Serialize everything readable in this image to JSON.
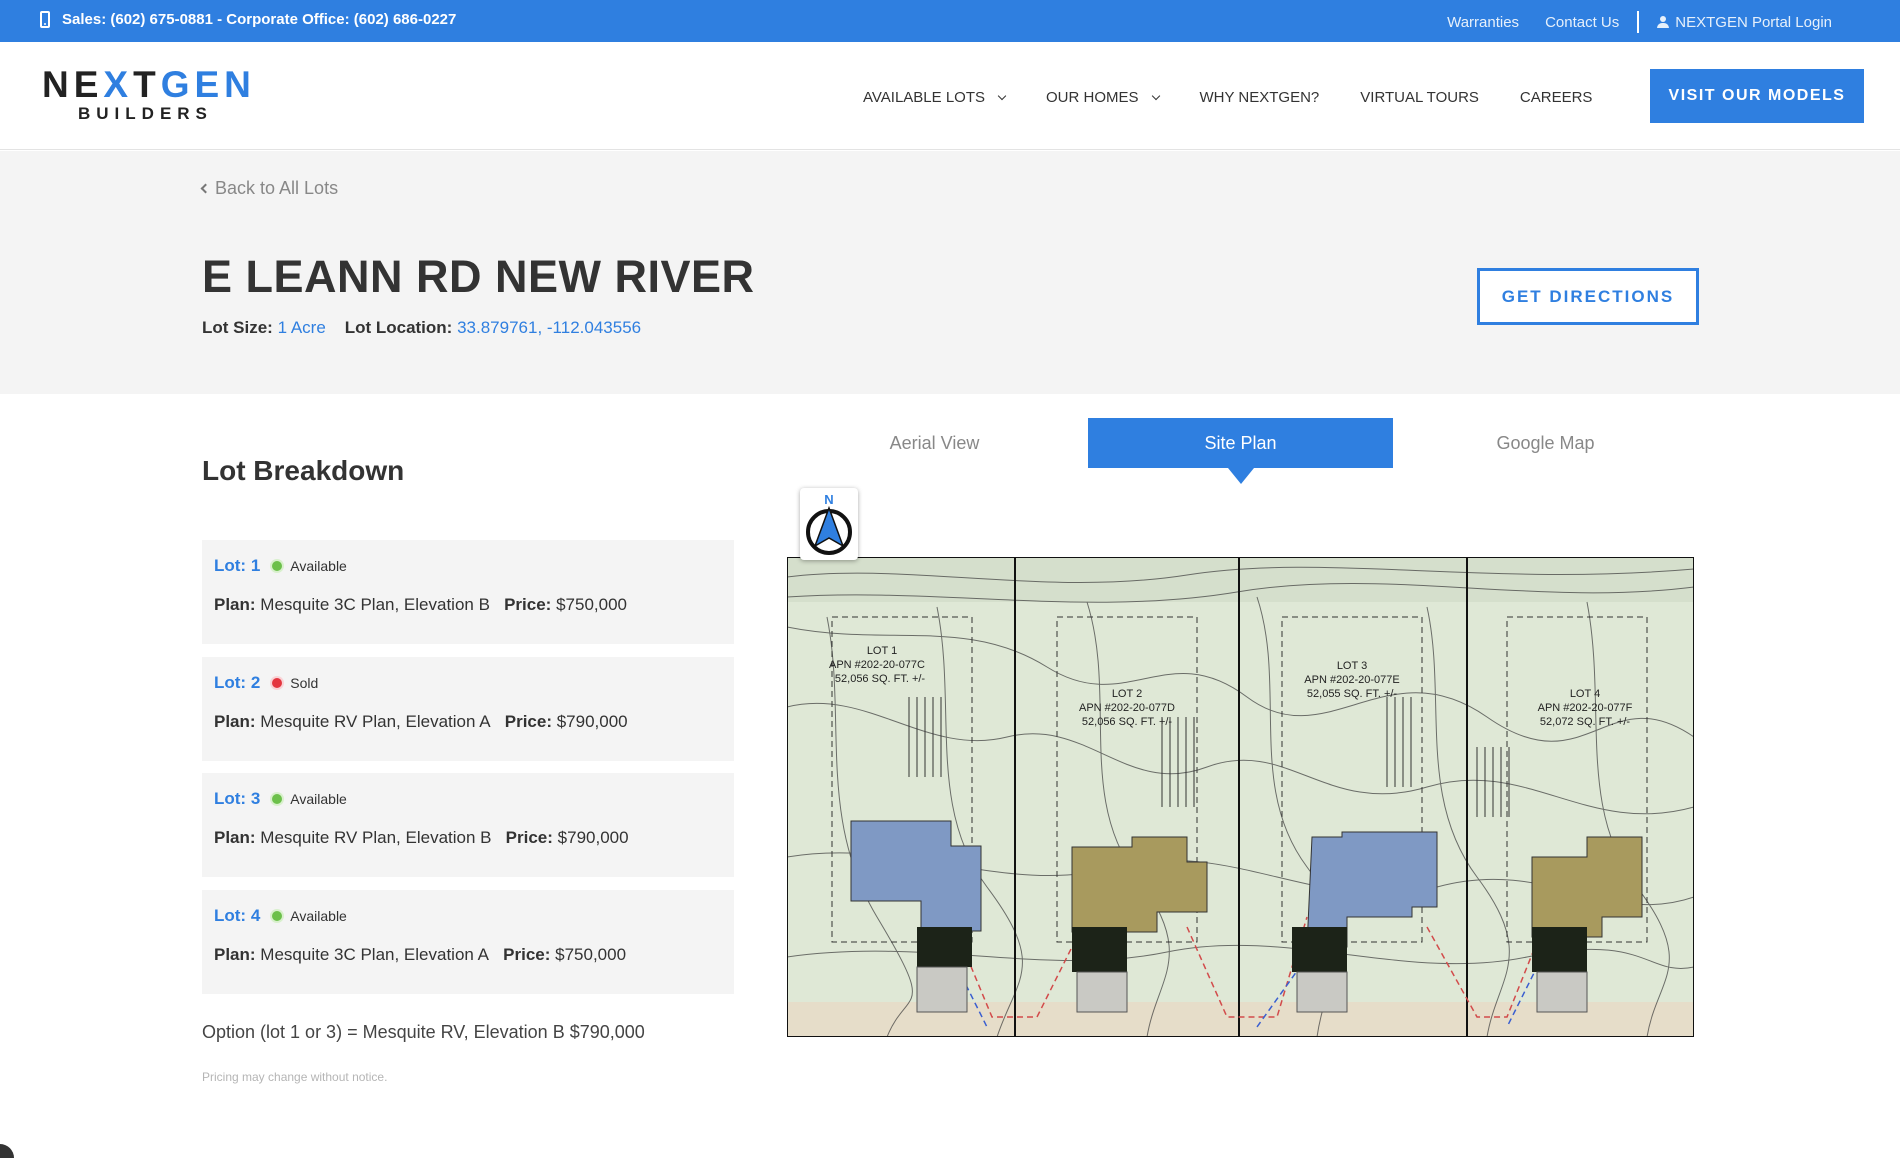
{
  "topbar": {
    "phone_text": "Sales: (602) 675-0881 - Corporate Office: (602) 686-0227",
    "links": [
      "Warranties",
      "Contact Us"
    ],
    "portal_label": "NEXTGEN Portal Login"
  },
  "header": {
    "logo_top": "NEXTGEN",
    "logo_bottom": "BUILDERS",
    "nav": [
      "AVAILABLE LOTS",
      "OUR HOMES",
      "WHY NEXTGEN?",
      "VIRTUAL TOURS",
      "CAREERS"
    ],
    "cta_label": "VISIT OUR MODELS"
  },
  "hero": {
    "back_label": "Back to All Lots",
    "title": "E LEANN RD NEW RIVER",
    "lot_size_label": "Lot Size:",
    "lot_size_value": "1 Acre",
    "lot_location_label": "Lot Location:",
    "lot_location_value": "33.879761, -112.043556",
    "directions_label": "GET DIRECTIONS"
  },
  "breakdown": {
    "title": "Lot Breakdown",
    "plan_label": "Plan:",
    "price_label": "Price:",
    "lots": [
      {
        "lot": "Lot: 1",
        "status": "Available",
        "plan": "Mesquite 3C Plan, Elevation B",
        "price": "$750,000"
      },
      {
        "lot": "Lot: 2",
        "status": "Sold",
        "plan": "Mesquite RV Plan, Elevation A",
        "price": "$790,000"
      },
      {
        "lot": "Lot: 3",
        "status": "Available",
        "plan": "Mesquite RV Plan, Elevation B",
        "price": "$790,000"
      },
      {
        "lot": "Lot: 4",
        "status": "Available",
        "plan": "Mesquite 3C Plan, Elevation A",
        "price": "$750,000"
      }
    ],
    "option_text": "Option (lot 1 or 3) = Mesquite RV, Elevation B $790,000",
    "disclaimer": "Pricing may change without notice."
  },
  "tabs": [
    "Aerial View",
    "Site Plan",
    "Google Map"
  ],
  "siteplan": {
    "compass_label": "N",
    "lots": [
      {
        "name": "LOT 1",
        "apn": "APN #202-20-077C",
        "area": "52,056 SQ. FT. +/-"
      },
      {
        "name": "LOT 2",
        "apn": "APN #202-20-077D",
        "area": "52,056 SQ. FT. +/-"
      },
      {
        "name": "LOT 3",
        "apn": "APN #202-20-077E",
        "area": "52,055 SQ. FT. +/-"
      },
      {
        "name": "LOT 4",
        "apn": "APN #202-20-077F",
        "area": "52,072 SQ. FT. +/-"
      }
    ],
    "colors": {
      "background": "#dfe8d6",
      "sold_home": "#a89a5e",
      "available_home": "#7f99c4",
      "road": "#e6ddc9"
    }
  }
}
